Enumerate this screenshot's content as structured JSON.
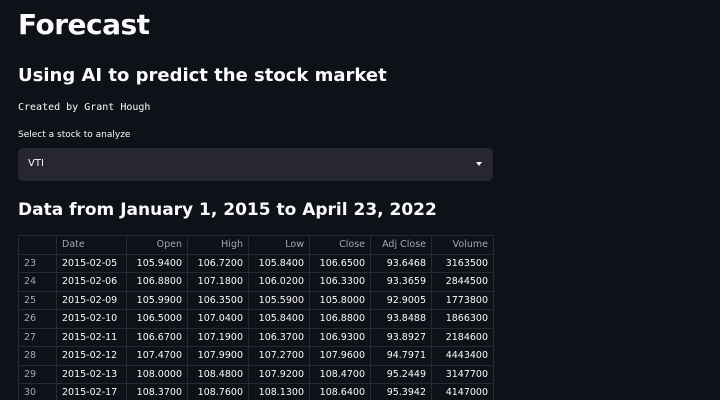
{
  "page": {
    "title": "Forecast",
    "subtitle": "Using AI to predict the stock market",
    "author": "Created by Grant Hough"
  },
  "stock_select": {
    "label": "Select a stock to analyze",
    "value": "VTI",
    "icon": "chevron-down-icon"
  },
  "data_section": {
    "heading": "Data from January 1, 2015 to April 23, 2022"
  },
  "table": {
    "columns": [
      "",
      "Date",
      "Open",
      "High",
      "Low",
      "Close",
      "Adj Close",
      "Volume"
    ],
    "rows": [
      [
        "23",
        "2015-02-05",
        "105.9400",
        "106.7200",
        "105.8400",
        "106.6500",
        "93.6468",
        "3163500"
      ],
      [
        "24",
        "2015-02-06",
        "106.8800",
        "107.1800",
        "106.0200",
        "106.3300",
        "93.3659",
        "2844500"
      ],
      [
        "25",
        "2015-02-09",
        "105.9900",
        "106.3500",
        "105.5900",
        "105.8000",
        "92.9005",
        "1773800"
      ],
      [
        "26",
        "2015-02-10",
        "106.5000",
        "107.0400",
        "105.8400",
        "106.8800",
        "93.8488",
        "1866300"
      ],
      [
        "27",
        "2015-02-11",
        "106.6700",
        "107.1900",
        "106.3700",
        "106.9300",
        "93.8927",
        "2184600"
      ],
      [
        "28",
        "2015-02-12",
        "107.4700",
        "107.9900",
        "107.2700",
        "107.9600",
        "94.7971",
        "4443400"
      ],
      [
        "29",
        "2015-02-13",
        "108.0000",
        "108.4800",
        "107.9200",
        "108.4700",
        "95.2449",
        "3147700"
      ],
      [
        "30",
        "2015-02-17",
        "108.3700",
        "108.7600",
        "108.1300",
        "108.6400",
        "95.3942",
        "4147000"
      ]
    ]
  }
}
